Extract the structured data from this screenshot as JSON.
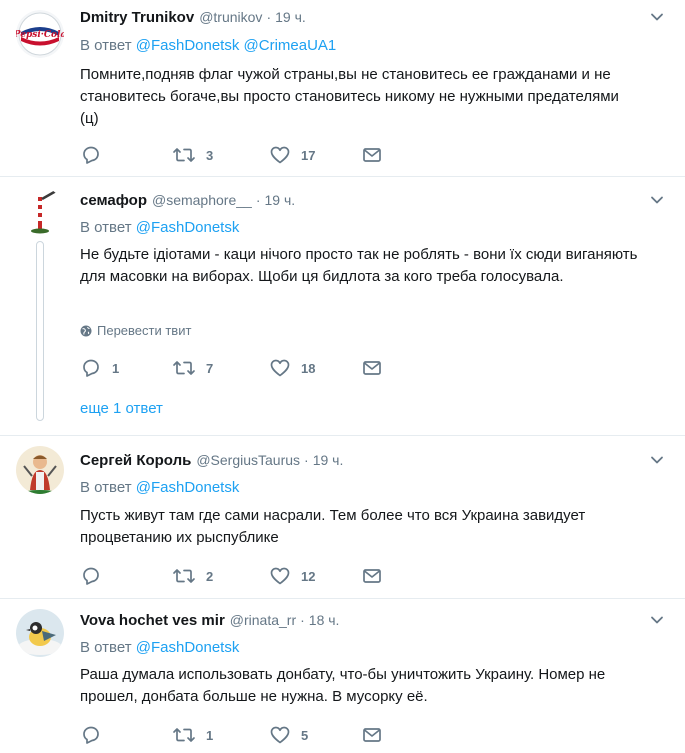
{
  "reply_prefix": "В ответ",
  "tweets": [
    {
      "name": "Dmitry Trunikov",
      "handle": "@trunikov",
      "time": "19 ч.",
      "reply_mentions": [
        "@FashDonetsk",
        "@CrimeaUA1"
      ],
      "text": "Помните,подняв флаг чужой страны,вы не становитесь ее гражданами и не становитесь богаче,вы просто становитесь никому не нужными предателями (ц)",
      "counts": {
        "reply": "",
        "retweet": "3",
        "like": "17"
      },
      "avatar_text": "Pepsi-Cola"
    },
    {
      "name": "семафор",
      "handle": "@semaphore__",
      "time": "19 ч.",
      "reply_mentions": [
        "@FashDonetsk"
      ],
      "text": "Не будьте ідіотами - каци нічого просто так не роблять - вони їх сюди виганяють для масовки на виборах. Щоби ця бидлота за кого треба голосувала.",
      "translate": "Перевести твит",
      "counts": {
        "reply": "1",
        "retweet": "7",
        "like": "18"
      },
      "more_replies": "еще 1 ответ"
    },
    {
      "name": "Сергей Король",
      "handle": "@SergiusTaurus",
      "time": "19 ч.",
      "reply_mentions": [
        "@FashDonetsk"
      ],
      "text": "Пусть живут там где сами насрали. Тем более что вся Украина завидует процветанию их рыспублике",
      "counts": {
        "reply": "",
        "retweet": "2",
        "like": "12"
      }
    },
    {
      "name": "Vova hochet ves mir",
      "handle": "@rinata_rr",
      "time": "18 ч.",
      "reply_mentions": [
        "@FashDonetsk"
      ],
      "text": "Раша думала использовать донбату, что-бы уничтожить Украину. Номер не прошел, донбата больше не нужна. В мусорку её.",
      "counts": {
        "reply": "",
        "retweet": "1",
        "like": "5"
      }
    }
  ],
  "colors": {
    "accent": "#1da1f2",
    "secondary_text": "#657786",
    "border": "#e6ecf0",
    "text": "#14171a"
  },
  "icons": {
    "reply": "reply-icon",
    "retweet": "retweet-icon",
    "like": "heart-icon",
    "dm": "envelope-icon",
    "caret": "chevron-down-icon",
    "translate": "globe-icon"
  }
}
